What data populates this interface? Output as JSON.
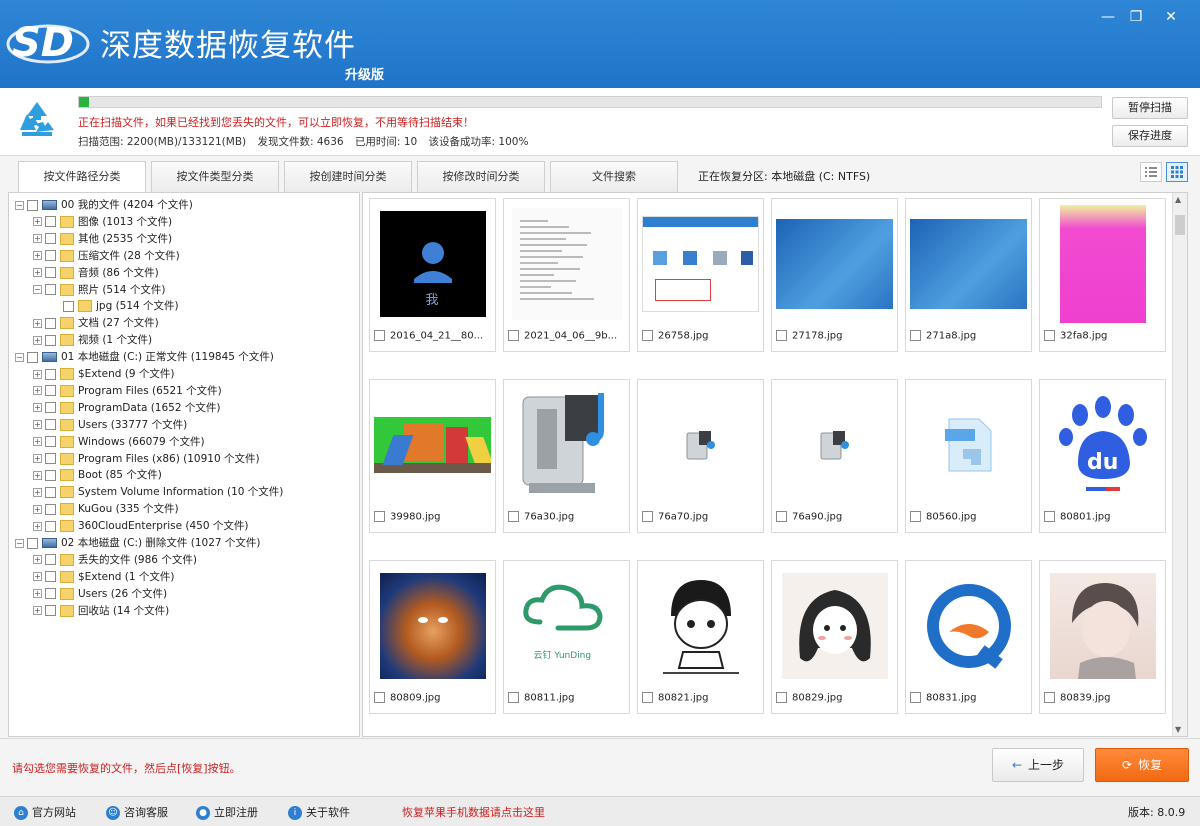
{
  "app": {
    "title": "深度数据恢复软件",
    "subtitle": "升级版",
    "logo_text": "SD"
  },
  "window_controls": [
    "minimize-icon",
    "restore-icon",
    "close-icon"
  ],
  "scan": {
    "progress": 0.01,
    "message": "正在扫描文件，如果已经找到您丢失的文件，可以立即恢复，不用等待扫描结束！",
    "range": "扫描范围: 2200(MB)/133121(MB)",
    "found": "发现文件数: 4636",
    "elapsed": "已用时间: 10",
    "rate": "该设备成功率: 100%",
    "pause_label": "暂停扫描",
    "save_label": "保存进度"
  },
  "tabs": [
    "按文件路径分类",
    "按文件类型分类",
    "按创建时间分类",
    "按修改时间分类",
    "文件搜索"
  ],
  "partition_text": "正在恢复分区: 本地磁盘 (C: NTFS)",
  "tree": [
    {
      "label": "00 我的文件  (4204 个文件)",
      "level": 0,
      "icon": "drive"
    },
    {
      "label": "图像   (1013 个文件)",
      "level": 1,
      "icon": "folder"
    },
    {
      "label": "其他   (2535 个文件)",
      "level": 1,
      "icon": "folder"
    },
    {
      "label": "压缩文件   (28 个文件)",
      "level": 1,
      "icon": "folder"
    },
    {
      "label": "音频   (86 个文件)",
      "level": 1,
      "icon": "folder"
    },
    {
      "label": "照片   (514 个文件)",
      "level": 1,
      "icon": "folder"
    },
    {
      "label": "jpg   (514 个文件)",
      "level": 2,
      "icon": "folder"
    },
    {
      "label": "文档   (27 个文件)",
      "level": 1,
      "icon": "folder"
    },
    {
      "label": "视频   (1 个文件)",
      "level": 1,
      "icon": "folder"
    },
    {
      "label": "01 本地磁盘 (C:) 正常文件  (119845 个文件)",
      "level": 0,
      "icon": "drive"
    },
    {
      "label": "$Extend   (9 个文件)",
      "level": 1,
      "icon": "folder"
    },
    {
      "label": "Program Files   (6521 个文件)",
      "level": 1,
      "icon": "folder"
    },
    {
      "label": "ProgramData   (1652 个文件)",
      "level": 1,
      "icon": "folder"
    },
    {
      "label": "Users   (33777 个文件)",
      "level": 1,
      "icon": "folder"
    },
    {
      "label": "Windows   (66079 个文件)",
      "level": 1,
      "icon": "folder"
    },
    {
      "label": "Program Files (x86)   (10910 个文件)",
      "level": 1,
      "icon": "folder"
    },
    {
      "label": "Boot   (85 个文件)",
      "level": 1,
      "icon": "folder"
    },
    {
      "label": "System Volume Information   (10 个文件)",
      "level": 1,
      "icon": "folder"
    },
    {
      "label": "KuGou   (335 个文件)",
      "level": 1,
      "icon": "folder"
    },
    {
      "label": "360CloudEnterprise   (450 个文件)",
      "level": 1,
      "icon": "folder"
    },
    {
      "label": "02 本地磁盘 (C:) 删除文件  (1027 个文件)",
      "level": 0,
      "icon": "drive"
    },
    {
      "label": "丢失的文件   (986 个文件)",
      "level": 1,
      "icon": "folder"
    },
    {
      "label": "$Extend   (1 个文件)",
      "level": 1,
      "icon": "folder"
    },
    {
      "label": "Users   (26 个文件)",
      "level": 1,
      "icon": "folder"
    },
    {
      "label": "回收站   (14 个文件)",
      "level": 1,
      "icon": "folder"
    }
  ],
  "thumbs": [
    {
      "name": "2016_04_21__80...",
      "kind": "avatar-me",
      "me_text": "我"
    },
    {
      "name": "2021_04_06__9b...",
      "kind": "document"
    },
    {
      "name": "26758.jpg",
      "kind": "screenshot"
    },
    {
      "name": "27178.jpg",
      "kind": "blue-gradient"
    },
    {
      "name": "271a8.jpg",
      "kind": "blue-gradient"
    },
    {
      "name": "32fa8.jpg",
      "kind": "pink"
    },
    {
      "name": "39980.jpg",
      "kind": "playground"
    },
    {
      "name": "76a30.jpg",
      "kind": "media-player-large"
    },
    {
      "name": "76a70.jpg",
      "kind": "media-player-small"
    },
    {
      "name": "76a90.jpg",
      "kind": "media-player-small"
    },
    {
      "name": "80560.jpg",
      "kind": "blue-file-icon"
    },
    {
      "name": "80801.jpg",
      "kind": "baidu-logo",
      "logo_text": "du"
    },
    {
      "name": "80809.jpg",
      "kind": "monkey-king"
    },
    {
      "name": "80811.jpg",
      "kind": "yunding-logo",
      "logo_text": "云钉 YunDing"
    },
    {
      "name": "80821.jpg",
      "kind": "cartoon-boy"
    },
    {
      "name": "80829.jpg",
      "kind": "cartoon-girl"
    },
    {
      "name": "80831.jpg",
      "kind": "q-logo"
    },
    {
      "name": "80839.jpg",
      "kind": "anime-boy"
    }
  ],
  "footer": {
    "hint": "请勾选您需要恢复的文件，然后点[恢复]按钮。",
    "prev_label": "上一步",
    "recover_label": "恢复"
  },
  "statusbar": {
    "links": [
      "官方网站",
      "咨询客服",
      "立即注册",
      "关于软件"
    ],
    "phone_link": "恢复苹果手机数据请点击这里",
    "version": "版本: 8.0.9"
  },
  "colors": {
    "title_blue": "#2f86d6",
    "accent_orange": "#f26a12",
    "alert_red": "#cc1f1f",
    "progress_green": "#27b43f"
  }
}
